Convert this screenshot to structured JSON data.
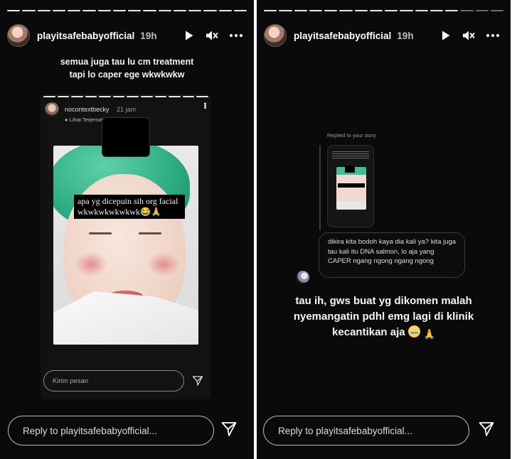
{
  "story_left": {
    "username": "playitsafebabyofficial",
    "time": "19h",
    "caption_line1": "semua juga tau lu cm treatment",
    "caption_line2": "tapi lo caper ege wkwkwkw",
    "embedded": {
      "username": "nocontextbecky",
      "time": "21 jam",
      "translate": "Lihat Terjemahan",
      "overlay_line1": "apa yg dicepuin sih org facial",
      "overlay_line2": "wkwkwkwkwkwk😂🙏",
      "reply_placeholder": "Kirim pesan"
    },
    "reply_placeholder": "Reply to playitsafebabyofficial..."
  },
  "story_right": {
    "username": "playitsafebabyofficial",
    "time": "19h",
    "replied_label": "Replied to your story",
    "dm_message": "dikira kita bodoh kaya dia kali ya? kita juga tau kali itu DNA salmon, lo aja yang CAPER ngang ngong ngang ngong",
    "caption_line1": "tau ih, gws buat yg dikomen malah",
    "caption_line2": "nyemangatin pdhl emg lagi di klinik",
    "caption_line3": "kecantikan aja",
    "reply_placeholder": "Reply to playitsafebabyofficial..."
  },
  "icons": [
    "play-icon",
    "mute-icon",
    "more-icon",
    "send-icon"
  ],
  "colors": {
    "background": "#0a0a0a",
    "text": "#ffffff",
    "cap_green": "#2fae85"
  }
}
